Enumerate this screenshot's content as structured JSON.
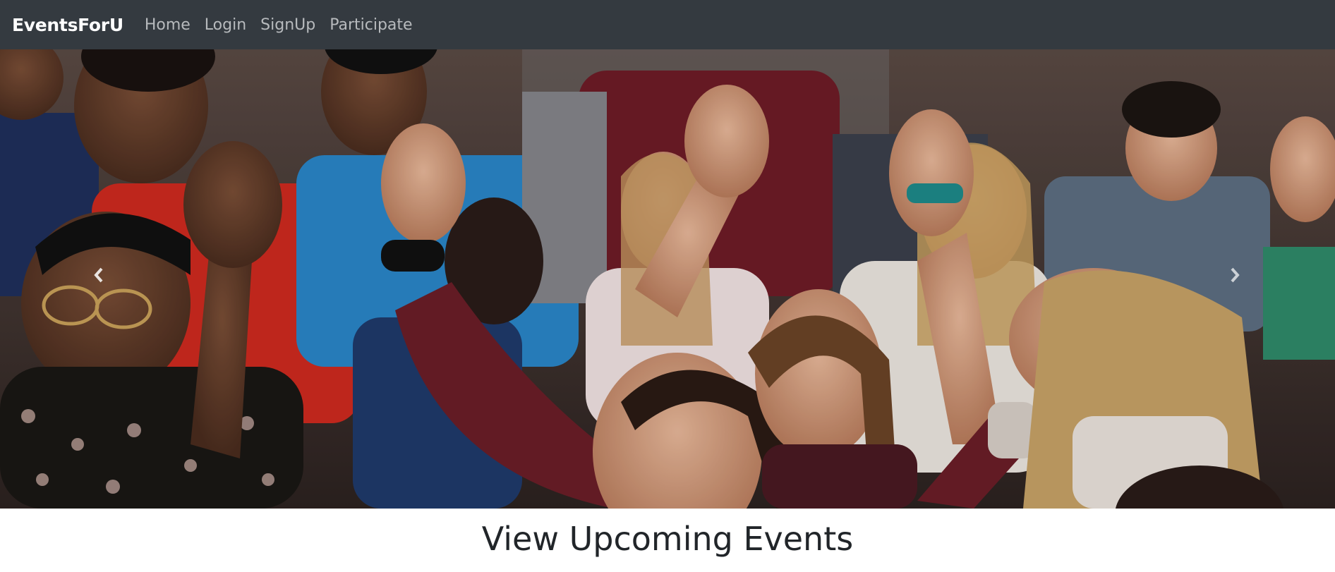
{
  "navbar": {
    "brand": "EventsForU",
    "links": [
      "Home",
      "Login",
      "SignUp",
      "Participate"
    ],
    "background": "#343a40",
    "link_color": "#b7babd"
  },
  "carousel": {
    "prev_icon": "chevron-left-icon",
    "next_icon": "chevron-right-icon"
  },
  "main": {
    "heading": "View Upcoming Events"
  }
}
